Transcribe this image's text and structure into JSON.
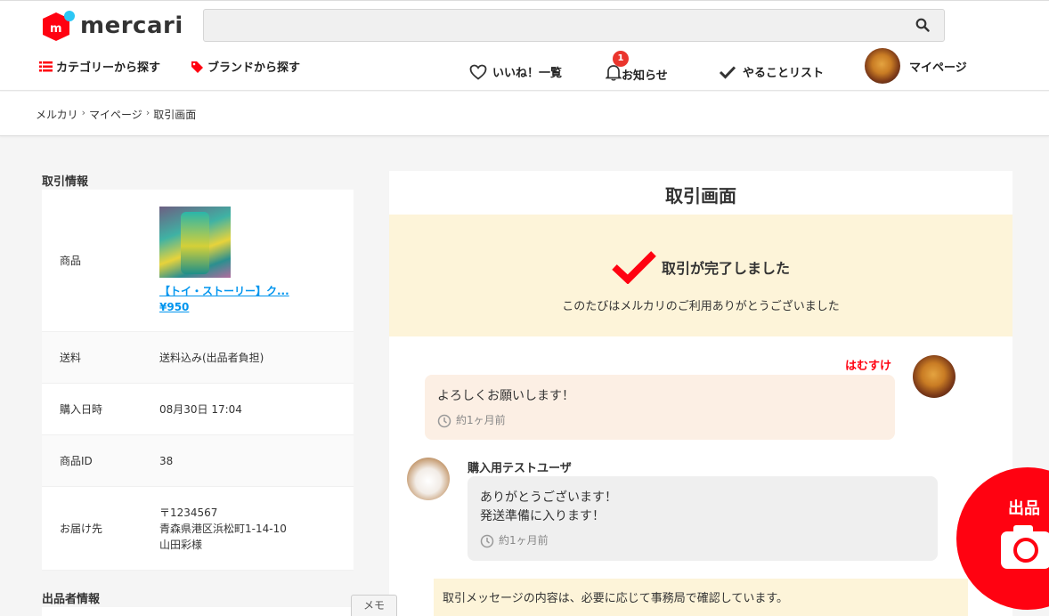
{
  "header": {
    "logo_text": "mercari",
    "search": {
      "placeholder": "",
      "value": ""
    },
    "nav_left": [
      {
        "label": "カテゴリーから探す",
        "icon": "list-icon"
      },
      {
        "label": "ブランドから探す",
        "icon": "tag-icon"
      }
    ],
    "nav_right": {
      "likes": "いいね！一覧",
      "notifications": "お知らせ",
      "notification_count": "1",
      "todo": "やることリスト",
      "mypage": "マイページ"
    }
  },
  "breadcrumb": [
    "メルカリ",
    "マイページ",
    "取引画面"
  ],
  "breadcrumb_sep": "›",
  "left": {
    "transaction_info_title": "取引情報",
    "seller_info_title": "出品者情報",
    "rows": {
      "product_label": "商品",
      "product_name": "【トイ・ストーリー】ク...",
      "product_price": "¥950",
      "shipping_label": "送料",
      "shipping_value": "送料込み(出品者負担)",
      "purchase_date_label": "購入日時",
      "purchase_date_value": "08月30日 17:04",
      "product_id_label": "商品ID",
      "product_id_value": "38",
      "delivery_label": "お届け先",
      "delivery_postal": "〒1234567",
      "delivery_address": "青森県港区浜松町1-14-10",
      "delivery_name": "山田彩様"
    }
  },
  "main": {
    "title": "取引画面",
    "completed_title": "取引が完了しました",
    "completed_sub": "このたびはメルカリのご利用ありがとうございました",
    "messages": [
      {
        "sender": "はむすけ",
        "text": "よろしくお願いします！",
        "time": "約1ヶ月前"
      },
      {
        "sender": "購入用テストユーザ",
        "line1": "ありがとうございます！",
        "line2": "発送準備に入ります！",
        "time": "約1ヶ月前"
      }
    ],
    "notice": "取引メッセージの内容は、必要に応じて事務局で確認しています。"
  },
  "sell_button": "出品",
  "memo_tab": "メモ",
  "colors": {
    "brand_red": "#ff0211",
    "link_blue": "#0095ee",
    "notice_bg": "#fdf4d9"
  }
}
